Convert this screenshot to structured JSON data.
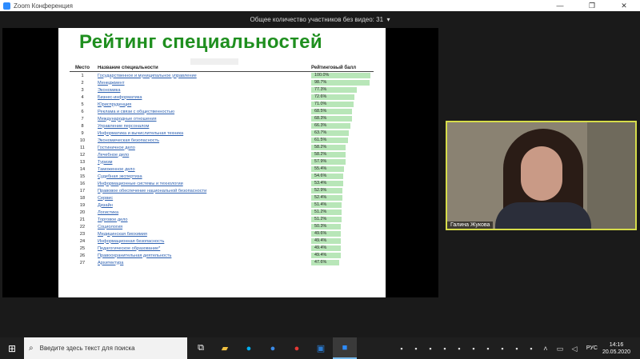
{
  "window": {
    "title": "Zoom Конференция",
    "controls": [
      "—",
      "❐",
      "✕"
    ]
  },
  "topbar": {
    "hidden_participants": "Общее количество участников без видео: 31"
  },
  "slide": {
    "title": "Рейтинг специальностей",
    "columns": [
      "Место",
      "Название специальности",
      "Рейтинговый балл"
    ],
    "rows": [
      {
        "rank": "1",
        "name": "Государственное и муниципальное управление",
        "score": "100.0%",
        "pct": 100.0
      },
      {
        "rank": "2",
        "name": "Менеджмент",
        "score": "98.7%",
        "pct": 98.7
      },
      {
        "rank": "3",
        "name": "Экономика",
        "score": "77.3%",
        "pct": 77.3
      },
      {
        "rank": "4",
        "name": "Бизнес-информатика",
        "score": "72.6%",
        "pct": 72.6
      },
      {
        "rank": "5",
        "name": "Юриспруденция",
        "score": "71.0%",
        "pct": 71.0
      },
      {
        "rank": "6",
        "name": "Реклама и связи с общественностью",
        "score": "68.5%",
        "pct": 68.5
      },
      {
        "rank": "7",
        "name": "Международные отношения",
        "score": "68.3%",
        "pct": 68.3
      },
      {
        "rank": "8",
        "name": "Управление персоналом",
        "score": "66.3%",
        "pct": 66.3
      },
      {
        "rank": "9",
        "name": "Информатика и вычислительная техника",
        "score": "63.7%",
        "pct": 63.7
      },
      {
        "rank": "10",
        "name": "Экономическая безопасность",
        "score": "61.5%",
        "pct": 61.5
      },
      {
        "rank": "11",
        "name": "Гостиничное дело",
        "score": "58.2%",
        "pct": 58.2
      },
      {
        "rank": "12",
        "name": "Лечебное дело",
        "score": "58.2%",
        "pct": 58.2
      },
      {
        "rank": "13",
        "name": "Туризм",
        "score": "57.9%",
        "pct": 57.9
      },
      {
        "rank": "14",
        "name": "Таможенное дело",
        "score": "55.4%",
        "pct": 55.4
      },
      {
        "rank": "15",
        "name": "Судебная экспертиза",
        "score": "54.6%",
        "pct": 54.6
      },
      {
        "rank": "16",
        "name": "Информационные системы и технологии",
        "score": "53.4%",
        "pct": 53.4
      },
      {
        "rank": "17",
        "name": "Правовое обеспечение национальной безопасности",
        "score": "52.9%",
        "pct": 52.9
      },
      {
        "rank": "18",
        "name": "Сервис",
        "score": "52.4%",
        "pct": 52.4
      },
      {
        "rank": "19",
        "name": "Дизайн",
        "score": "51.4%",
        "pct": 51.4
      },
      {
        "rank": "20",
        "name": "Логистика",
        "score": "51.2%",
        "pct": 51.2
      },
      {
        "rank": "21",
        "name": "Торговое дело",
        "score": "51.2%",
        "pct": 51.2
      },
      {
        "rank": "22",
        "name": "Социология",
        "score": "50.3%",
        "pct": 50.3
      },
      {
        "rank": "23",
        "name": "Медицинская биохимия",
        "score": "49.6%",
        "pct": 49.6
      },
      {
        "rank": "24",
        "name": "Информационная безопасность",
        "score": "49.4%",
        "pct": 49.4
      },
      {
        "rank": "25",
        "name": "Педагогическое образование*",
        "score": "49.4%",
        "pct": 49.4
      },
      {
        "rank": "26",
        "name": "Правоохранительная деятельность",
        "score": "49.4%",
        "pct": 49.4
      },
      {
        "rank": "27",
        "name": "Архитектура",
        "score": "47.6%",
        "pct": 47.6
      }
    ]
  },
  "video": {
    "participant_name": "Галина Жукова"
  },
  "taskbar": {
    "search_placeholder": "Введите здесь текст для поиска",
    "language": "РУС",
    "time": "14:16",
    "date": "20.05.2020"
  }
}
